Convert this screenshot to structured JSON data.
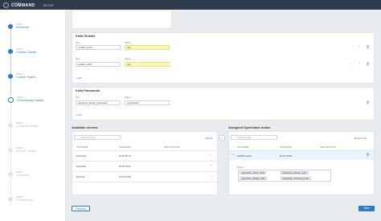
{
  "header": {
    "brand_top": "CONTRAIL",
    "brand_main": "COMMAND",
    "section": "SETUP"
  },
  "steps": [
    {
      "num": "STEP 1",
      "label": "Inventory",
      "state": "done"
    },
    {
      "num": "STEP 2",
      "label": "Control Cluster",
      "state": "done"
    },
    {
      "num": "STEP 3",
      "label": "Control Nodes",
      "state": "done"
    },
    {
      "num": "STEP 4",
      "label": "Orchestrator Nodes",
      "state": "active"
    },
    {
      "num": "STEP 5",
      "label": "Compute Nodes",
      "state": "todo"
    },
    {
      "num": "STEP 6",
      "label": "Service Nodes",
      "state": "todo"
    },
    {
      "num": "STEP 7",
      "label": "Summary",
      "state": "todo"
    },
    {
      "num": "STEP 8",
      "label": "Provisioning",
      "state": "todo"
    }
  ],
  "kolla_globals": {
    "title": "Kolla Globals",
    "key_label": "Key",
    "value_label": "Value",
    "rows": [
      {
        "key": "enable_ironic",
        "value": "yes"
      },
      {
        "key": "enable_swift",
        "value": "yes"
      }
    ],
    "add_label": "+ Add"
  },
  "kolla_passwords": {
    "title": "Kolla Passwords",
    "key_label": "Key",
    "value_label": "Value",
    "rows": [
      {
        "key": "keystone_admin_password",
        "value": "contrail123"
      }
    ],
    "add_label": "+ Add"
  },
  "available": {
    "title": "Available servers",
    "search_placeholder": "Search servers",
    "add_all": "Add All",
    "columns": [
      "HOSTNAME",
      "IP ADDRESS",
      "DISK PARTITION"
    ],
    "rows": [
      {
        "hostname": "kvmhost1",
        "ip": "10.87.79.72",
        "disk": ""
      },
      {
        "hostname": "kvmhost2",
        "ip": "10.87.79.67",
        "disk": ""
      },
      {
        "hostname": "kvmhost",
        "ip": "10.87.79.69",
        "disk": ""
      }
    ]
  },
  "assigned": {
    "title": "Assigned Openstack nodes",
    "search_placeholder": "Search nodes",
    "remove_all": "Remove all",
    "columns": [
      "HOSTNAME",
      "IP ADDRESS",
      "DISK PARTITION"
    ],
    "row": {
      "hostname": "b1s0d7-node1",
      "ip": "10.87.79.66",
      "disk": ""
    },
    "roles_label": "Roles *",
    "roles": [
      "openstack_control_node",
      "openstack_network_node",
      "openstack_storage_node",
      "openstack_monitoring_node"
    ]
  },
  "footer": {
    "previous": "Previous",
    "next": "Next"
  },
  "colors": {
    "accent": "#2f7cc2",
    "topbar": "#2d3a4a",
    "highlight": "#fbf7b4"
  },
  "icons": {
    "swap_left": "chevron-left-icon",
    "expand_row": "chevron-right-icon"
  }
}
